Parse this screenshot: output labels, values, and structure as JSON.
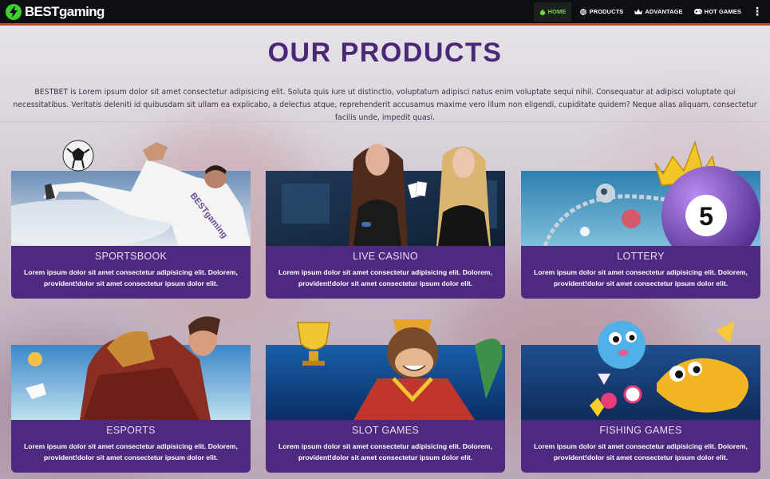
{
  "brand": {
    "name": "BESTgaming"
  },
  "nav": {
    "items": [
      {
        "label": "HOME",
        "icon": "fire-icon",
        "active": true
      },
      {
        "label": "PRODUCTS",
        "icon": "globe-icon",
        "active": false
      },
      {
        "label": "ADVANTAGE",
        "icon": "crown-icon",
        "active": false
      },
      {
        "label": "HOT GAMES",
        "icon": "gamepad-icon",
        "active": false
      }
    ],
    "more_icon": "kebab-menu-icon"
  },
  "page": {
    "title": "OUR PRODUCTS",
    "intro": "BESTBET is Lorem ipsum dolor sit amet consectetur adipisicing elit. Soluta quis iure ut distinctio, voluptatum adipisci natus enim voluptate sequi nihil. Consequatur at adipisci voluptate qui necessitatibus. Veritatis deleniti id quibusdam sit ullam ea explicabo, a delectus atque, reprehenderit accusamus maxime vero illum non eligendi, cupiditate quidem? Neque alias aliquam, consectetur facilis unde, impedit quasi."
  },
  "products": [
    {
      "name": "SPORTSBOOK",
      "desc": "Lorem ipsum dolor sit amet consectetur adipisicing elit. Dolorem, provident!dolor sit amet consectetur ipsum dolor elit."
    },
    {
      "name": "LIVE CASINO",
      "desc": "Lorem ipsum dolor sit amet consectetur adipisicing elit. Dolorem, provident!dolor sit amet consectetur ipsum dolor elit."
    },
    {
      "name": "LOTTERY",
      "desc": "Lorem ipsum dolor sit amet consectetur adipisicing elit. Dolorem, provident!dolor sit amet consectetur ipsum dolor elit."
    },
    {
      "name": "ESPORTS",
      "desc": "Lorem ipsum dolor sit amet consectetur adipisicing elit. Dolorem, provident!dolor sit amet consectetur ipsum dolor elit."
    },
    {
      "name": "SLOT GAMES",
      "desc": "Lorem ipsum dolor sit amet consectetur adipisicing elit. Dolorem, provident!dolor sit amet consectetur ipsum dolor elit."
    },
    {
      "name": "FISHING GAMES",
      "desc": "Lorem ipsum dolor sit amet consectetur adipisicing elit. Dolorem, provident!dolor sit amet consectetur ipsum dolor elit."
    }
  ],
  "art": {
    "sportsbook": {
      "jersey_text": "BESTgaming"
    },
    "lottery": {
      "ball_number": "5"
    }
  },
  "colors": {
    "nav_bg": "#0d0f14",
    "nav_accent_border": "#b34b2d",
    "active_nav_text": "#7ad34b",
    "title": "#4a2877",
    "card_info_bg": "#4d2a80",
    "logo_badge": "#3ed02b"
  }
}
